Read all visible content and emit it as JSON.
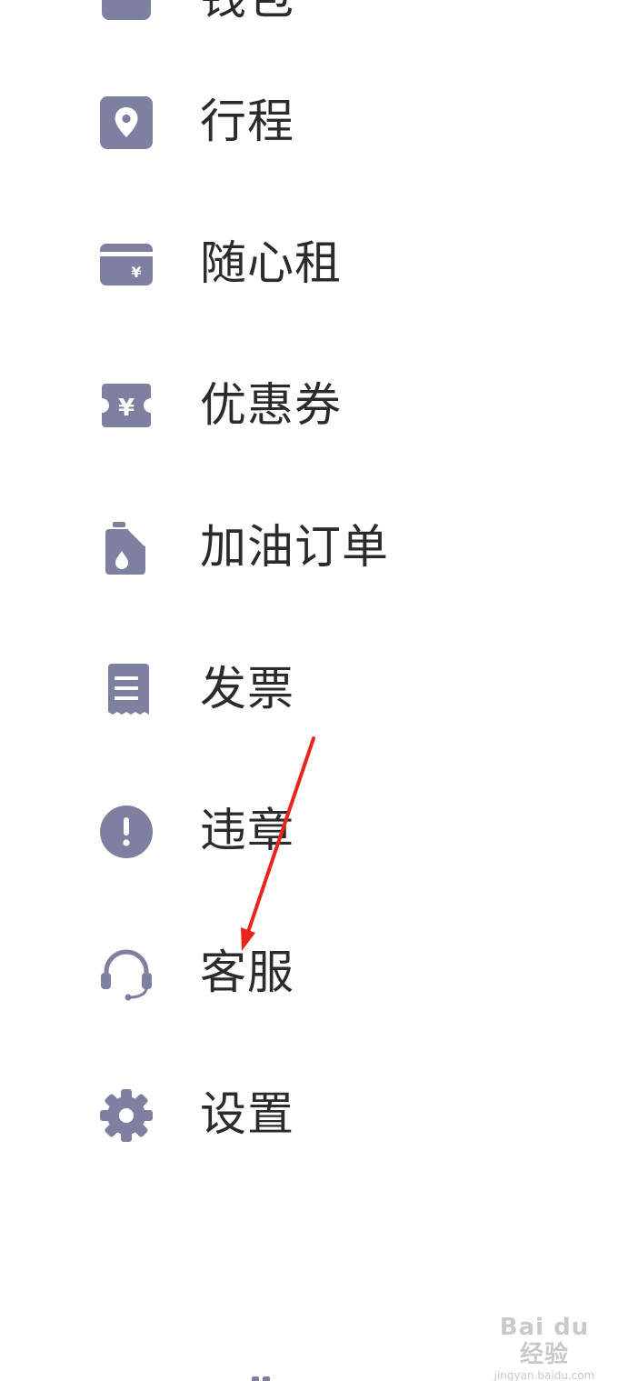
{
  "menu": {
    "items": [
      {
        "id": "partial-top",
        "label": "钱包",
        "icon": "wallet-icon"
      },
      {
        "id": "trip",
        "label": "行程",
        "icon": "location-pin-icon"
      },
      {
        "id": "rental",
        "label": "随心租",
        "icon": "yuan-card-icon"
      },
      {
        "id": "coupon",
        "label": "优惠券",
        "icon": "yuan-ticket-icon"
      },
      {
        "id": "fuel",
        "label": "加油订单",
        "icon": "fuel-can-icon"
      },
      {
        "id": "invoice",
        "label": "发票",
        "icon": "receipt-icon"
      },
      {
        "id": "violation",
        "label": "违章",
        "icon": "exclamation-circle-icon"
      },
      {
        "id": "support",
        "label": "客服",
        "icon": "headset-icon"
      },
      {
        "id": "settings",
        "label": "设置",
        "icon": "gear-icon"
      }
    ]
  },
  "colors": {
    "icon": "#7f7fa0",
    "text": "#2b2b2b",
    "annotation": "#e8241c",
    "background": "#ffffff"
  },
  "watermark": {
    "main": "Bai du 经验",
    "sub": "jingyan.baidu.com"
  }
}
